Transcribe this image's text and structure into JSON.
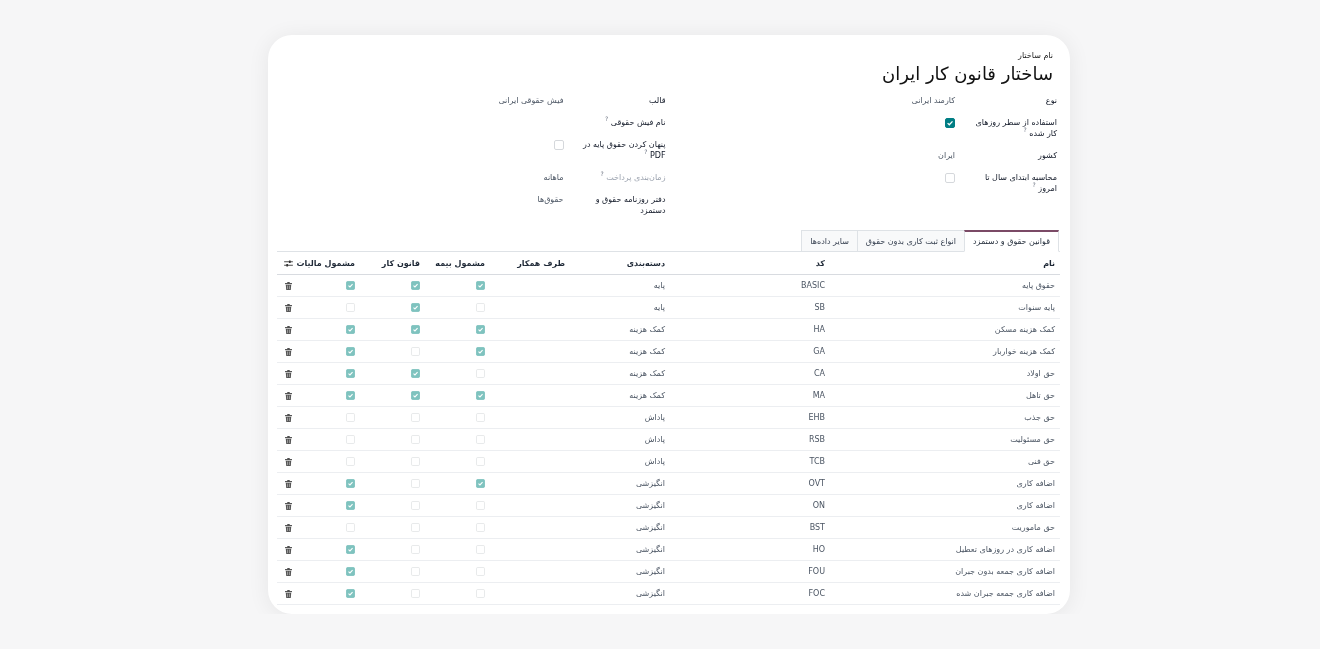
{
  "form": {
    "name_label": "نام ساختار",
    "title": "ساختار قانون کار ایران",
    "groups": [
      {
        "fields": [
          {
            "kind": "text",
            "label": "نوع",
            "value": "کارمند ایرانی",
            "muted": false
          },
          {
            "kind": "checkbox",
            "label": "استفاده از سطر روزهای کار شده $^{?}$",
            "checked": true,
            "muted": false
          },
          {
            "kind": "text",
            "label": "کشور",
            "value": "ایران",
            "muted": false
          },
          {
            "kind": "checkbox",
            "label": "محاسبه ابتدای سال تا امروز $^{?}$",
            "checked": false,
            "muted": false
          }
        ]
      },
      {
        "fields": [
          {
            "kind": "text",
            "label": "قالب",
            "value": "فیش حقوقی ایرانی",
            "muted": false
          },
          {
            "kind": "text",
            "label": "نام فیش حقوقی $^{?}$",
            "muted": false
          },
          {
            "kind": "checkbox",
            "label": "پنهان کردن حقوق پایه در PDF $^{?}$",
            "checked": false,
            "muted": false
          },
          {
            "kind": "text",
            "label": "زمان‌بندی پرداخت $^{?}$",
            "value": "ماهانه",
            "muted": true
          },
          {
            "kind": "text",
            "label": "دفتر روزنامه حقوق و دستمزد",
            "value": "حقوق‌ها",
            "muted": false
          }
        ]
      }
    ]
  },
  "tabs": [
    {
      "label": "قوانین حقوق و دستمزد",
      "selected": true
    },
    {
      "label": "انواع ثبت کاری بدون حقوق",
      "selected": false
    },
    {
      "label": "سایر داده‌ها",
      "selected": false
    }
  ],
  "table": {
    "columns": [
      {
        "label": "نام",
        "kind": "text"
      },
      {
        "label": "کد",
        "kind": "text"
      },
      {
        "label": "دسته‌بندی",
        "kind": "text"
      },
      {
        "label": "طرف همکار",
        "kind": "text"
      },
      {
        "label": "مشمول بیمه",
        "kind": "checkbox"
      },
      {
        "label": "قانون کار",
        "kind": "checkbox"
      },
      {
        "label": "مشمول مالیات",
        "kind": "checkbox"
      }
    ],
    "rows": [
      {
        "name": "حقوق پایه",
        "code": "BASIC",
        "category": "پایه",
        "insurance": true,
        "labor_law": true,
        "tax": true
      },
      {
        "name": "پایه سنوات",
        "code": "SB",
        "category": "پایه",
        "insurance": false,
        "labor_law": true,
        "tax": false
      },
      {
        "name": "کمک هزینه مسکن",
        "code": "HA",
        "category": "کمک هزینه",
        "insurance": true,
        "labor_law": true,
        "tax": true
      },
      {
        "name": "کمک هزینه خواربار",
        "code": "GA",
        "category": "کمک هزینه",
        "insurance": true,
        "labor_law": false,
        "tax": true
      },
      {
        "name": "حق اولاد",
        "code": "CA",
        "category": "کمک هزینه",
        "insurance": false,
        "labor_law": true,
        "tax": true
      },
      {
        "name": "حق تاهل",
        "code": "MA",
        "category": "کمک هزینه",
        "insurance": true,
        "labor_law": true,
        "tax": true
      },
      {
        "name": "حق جذب",
        "code": "EHB",
        "category": "پاداش",
        "insurance": false,
        "labor_law": false,
        "tax": false
      },
      {
        "name": "حق مسئولیت",
        "code": "RSB",
        "category": "پاداش",
        "insurance": false,
        "labor_law": false,
        "tax": false
      },
      {
        "name": "حق فنی",
        "code": "TCB",
        "category": "پاداش",
        "insurance": false,
        "labor_law": false,
        "tax": false
      },
      {
        "name": "اضافه کاری",
        "code": "OVT",
        "category": "انگیزشی",
        "insurance": true,
        "labor_law": false,
        "tax": true
      },
      {
        "name": "اضافه کاری",
        "code": "ON",
        "category": "انگیزشی",
        "insurance": false,
        "labor_law": false,
        "tax": true
      },
      {
        "name": "حق ماموریت",
        "code": "BST",
        "category": "انگیزشی",
        "insurance": false,
        "labor_law": false,
        "tax": false
      },
      {
        "name": "اضافه کاری در روزهای تعطیل",
        "code": "HO",
        "category": "انگیزشی",
        "insurance": false,
        "labor_law": false,
        "tax": true
      },
      {
        "name": "اضافه کاری جمعه بدون جبران",
        "code": "FOU",
        "category": "انگیزشی",
        "insurance": false,
        "labor_law": false,
        "tax": true
      },
      {
        "name": "اضافه کاری جمعه جبران شده",
        "code": "FOC",
        "category": "انگیزشی",
        "insurance": false,
        "labor_law": false,
        "tax": true
      }
    ]
  }
}
